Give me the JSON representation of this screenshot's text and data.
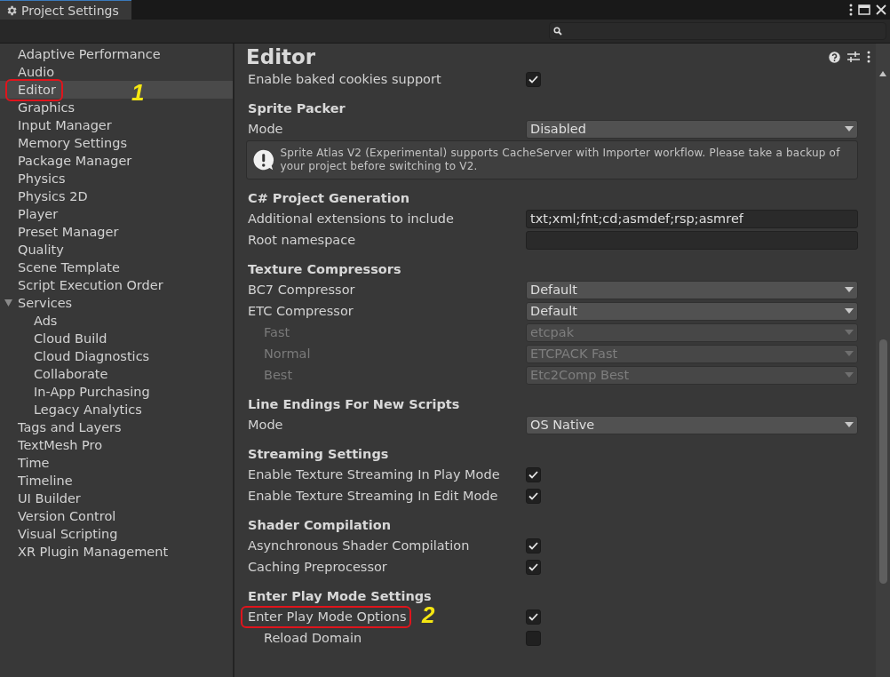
{
  "window": {
    "title": "Project Settings"
  },
  "sidebar": {
    "items": [
      {
        "label": "Adaptive Performance",
        "selected": false
      },
      {
        "label": "Audio",
        "selected": false
      },
      {
        "label": "Editor",
        "selected": true,
        "circled": true,
        "note": "1"
      },
      {
        "label": "Graphics",
        "selected": false
      },
      {
        "label": "Input Manager",
        "selected": false
      },
      {
        "label": "Memory Settings",
        "selected": false
      },
      {
        "label": "Package Manager",
        "selected": false
      },
      {
        "label": "Physics",
        "selected": false
      },
      {
        "label": "Physics 2D",
        "selected": false
      },
      {
        "label": "Player",
        "selected": false
      },
      {
        "label": "Preset Manager",
        "selected": false
      },
      {
        "label": "Quality",
        "selected": false
      },
      {
        "label": "Scene Template",
        "selected": false
      },
      {
        "label": "Script Execution Order",
        "selected": false
      },
      {
        "label": "Services",
        "selected": false,
        "expanded": true,
        "children": [
          {
            "label": "Ads",
            "selected": false
          },
          {
            "label": "Cloud Build",
            "selected": false
          },
          {
            "label": "Cloud Diagnostics",
            "selected": false
          },
          {
            "label": "Collaborate",
            "selected": false
          },
          {
            "label": "In-App Purchasing",
            "selected": false
          },
          {
            "label": "Legacy Analytics",
            "selected": false
          }
        ]
      },
      {
        "label": "Tags and Layers",
        "selected": false
      },
      {
        "label": "TextMesh Pro",
        "selected": false
      },
      {
        "label": "Time",
        "selected": false
      },
      {
        "label": "Timeline",
        "selected": false
      },
      {
        "label": "UI Builder",
        "selected": false
      },
      {
        "label": "Version Control",
        "selected": false
      },
      {
        "label": "Visual Scripting",
        "selected": false
      },
      {
        "label": "XR Plugin Management",
        "selected": false
      }
    ]
  },
  "panel": {
    "title": "Editor",
    "rows": [
      {
        "kind": "toggle",
        "label": "Enable baked cookies support",
        "checked": true
      },
      {
        "kind": "section",
        "label": "Sprite Packer"
      },
      {
        "kind": "dropdown",
        "label": "Mode",
        "value": "Disabled",
        "disabled": false
      },
      {
        "kind": "help",
        "text": "Sprite Atlas V2 (Experimental) supports CacheServer with Importer workflow. Please take a backup of your project before switching to V2."
      },
      {
        "kind": "section",
        "label": "C# Project Generation"
      },
      {
        "kind": "text",
        "label": "Additional extensions to include",
        "value": "txt;xml;fnt;cd;asmdef;rsp;asmref"
      },
      {
        "kind": "text",
        "label": "Root namespace"
      },
      {
        "kind": "section",
        "label": "Texture Compressors"
      },
      {
        "kind": "dropdown",
        "label": "BC7 Compressor",
        "value": "Default",
        "disabled": false
      },
      {
        "kind": "dropdown",
        "label": "ETC Compressor",
        "value": "Default",
        "disabled": false,
        "children": [
          {
            "kind": "dropdown",
            "label": "Fast",
            "value": "etcpak",
            "disabled": true
          },
          {
            "kind": "dropdown",
            "label": "Normal",
            "value": "ETCPACK Fast",
            "disabled": true
          },
          {
            "kind": "dropdown",
            "label": "Best",
            "value": "Etc2Comp Best",
            "disabled": true
          }
        ]
      },
      {
        "kind": "section",
        "label": "Line Endings For New Scripts"
      },
      {
        "kind": "dropdown",
        "label": "Mode",
        "value": "OS Native",
        "disabled": false
      },
      {
        "kind": "section",
        "label": "Streaming Settings"
      },
      {
        "kind": "toggle",
        "label": "Enable Texture Streaming In Play Mode",
        "checked": true
      },
      {
        "kind": "toggle",
        "label": "Enable Texture Streaming In Edit Mode",
        "checked": true
      },
      {
        "kind": "section",
        "label": "Shader Compilation"
      },
      {
        "kind": "toggle",
        "label": "Asynchronous Shader Compilation",
        "checked": true
      },
      {
        "kind": "toggle",
        "label": "Caching Preprocessor",
        "checked": true
      },
      {
        "kind": "section",
        "label": "Enter Play Mode Settings"
      },
      {
        "kind": "toggle",
        "label": "Enter Play Mode Options",
        "checked": true,
        "circled": true,
        "note": "2",
        "children": [
          {
            "kind": "toggle",
            "label": "Reload Domain",
            "checked": false
          }
        ]
      }
    ]
  }
}
